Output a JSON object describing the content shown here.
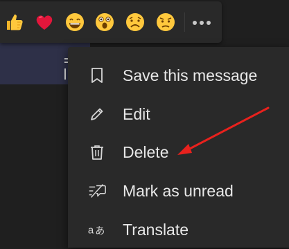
{
  "reactions": [
    {
      "icon": "thumbs-up-icon"
    },
    {
      "icon": "heart-icon"
    },
    {
      "icon": "laugh-emoji-icon"
    },
    {
      "icon": "surprised-emoji-icon"
    },
    {
      "icon": "sad-emoji-icon"
    },
    {
      "icon": "angry-emoji-icon"
    }
  ],
  "more_options_icon": "more-options-icon",
  "menu": {
    "items": [
      {
        "label": "Save this message",
        "icon": "bookmark-icon"
      },
      {
        "label": "Edit",
        "icon": "pencil-icon"
      },
      {
        "label": "Delete",
        "icon": "trash-icon"
      },
      {
        "label": "Mark as unread",
        "icon": "mark-unread-icon"
      },
      {
        "label": "Translate",
        "icon": "translate-icon"
      }
    ]
  },
  "annotation": {
    "color": "#e8211d",
    "points_to": "Delete"
  },
  "colors": {
    "menu_bg": "#292929",
    "text": "#e8e8e8",
    "message_bg": "#2e3048"
  }
}
